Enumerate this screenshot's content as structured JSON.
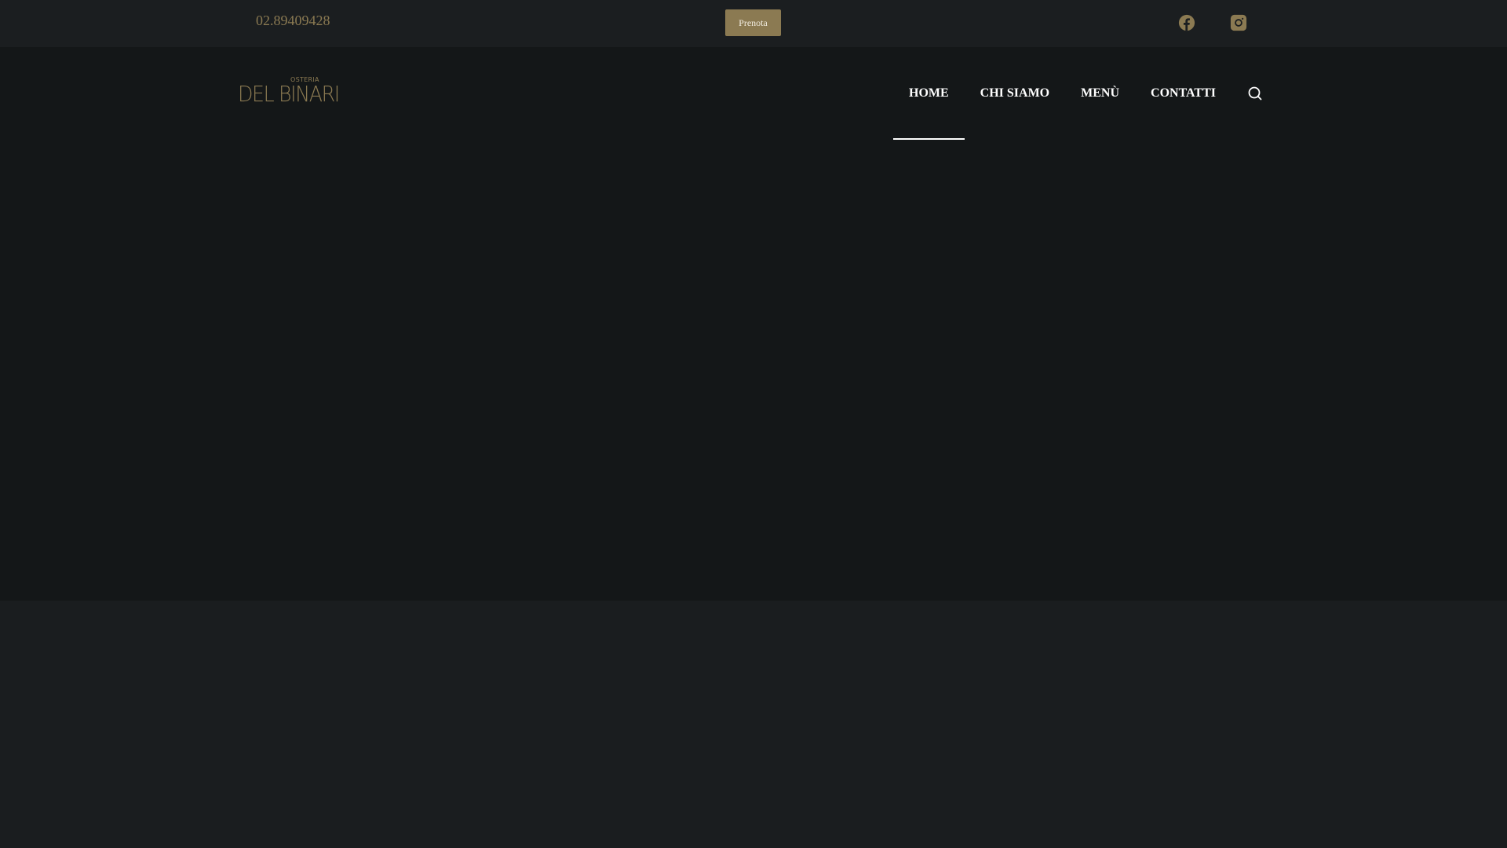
{
  "topbar": {
    "phone": "02.89409428",
    "book_label": "Prenota",
    "social": [
      "facebook-icon",
      "instagram-icon"
    ]
  },
  "logo": {
    "small": "OSTERIA",
    "big": "DEL BINARI"
  },
  "nav": {
    "items": [
      {
        "label": "HOME",
        "active": true
      },
      {
        "label": "CHI SIAMO"
      },
      {
        "label": "MENÙ"
      },
      {
        "label": "CONTATTI"
      }
    ]
  },
  "colors": {
    "accent": "#8b7a52",
    "topbar": "#1b1e20",
    "header": "#141718",
    "page": "#1a1d1f"
  }
}
